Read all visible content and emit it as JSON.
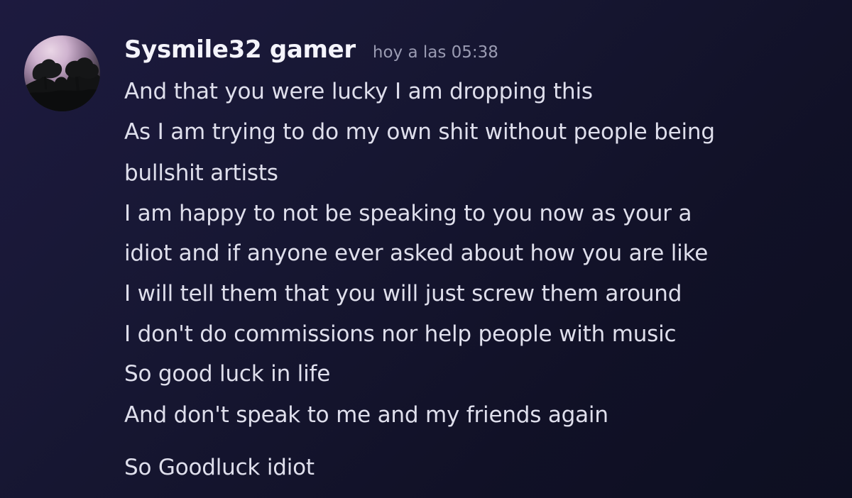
{
  "message": {
    "author": "Sysmile32 gamer",
    "timestamp": "hoy a las 05:38",
    "lines": [
      "And that you were lucky I am dropping this",
      "As I am trying to do my own shit without people being",
      "bullshit artists",
      "I am happy to not be speaking to you now as your a",
      "idiot and if anyone ever asked about how you are like",
      "I will tell them that you will just screw them around",
      "I don't do commissions nor help people with music",
      "So good luck in life",
      "And don't speak to me and my friends again",
      "So Goodluck idiot"
    ]
  },
  "colors": {
    "background": "#171733",
    "author": "#f4f4fb",
    "timestamp": "#9a9bb2",
    "text": "#dfdfec"
  },
  "icons": {
    "avatar": "profile-avatar-tree-silhouette"
  }
}
